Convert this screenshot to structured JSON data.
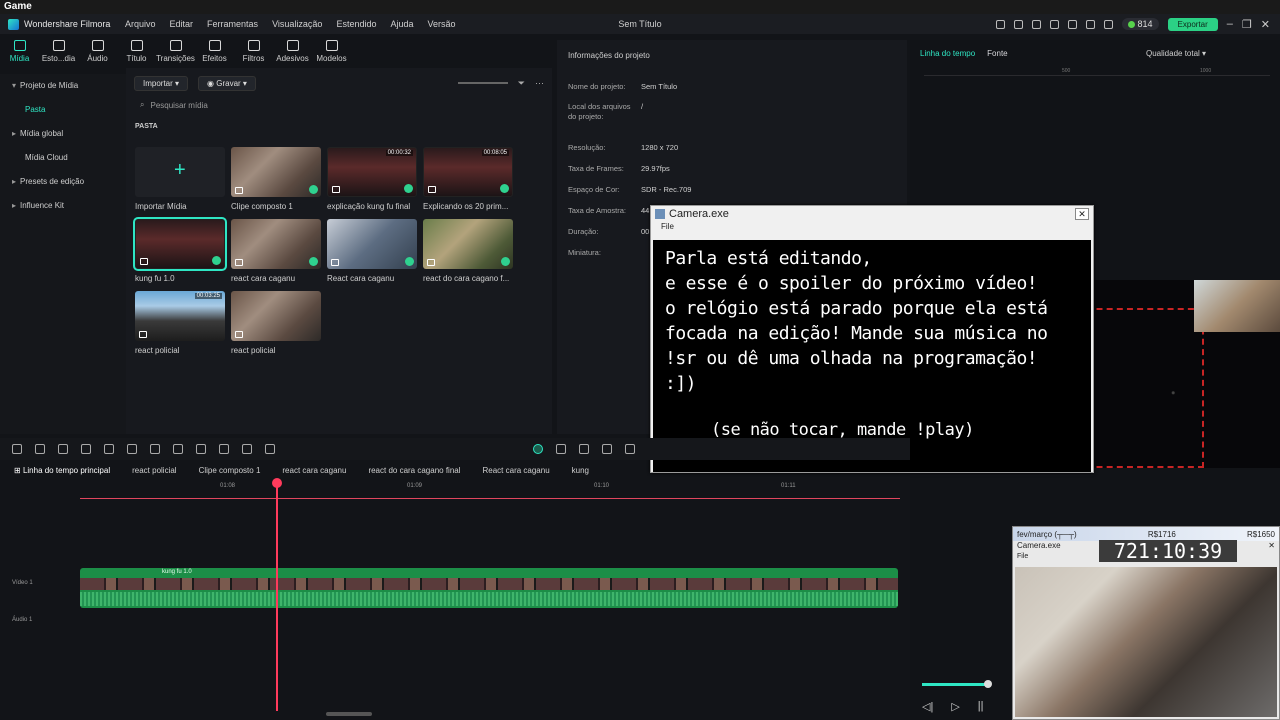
{
  "os_title": "Game",
  "app": {
    "name": "Wondershare Filmora",
    "window_title": "Sem Título",
    "menu": [
      "Arquivo",
      "Editar",
      "Ferramentas",
      "Visualização",
      "Estendido",
      "Ajuda",
      "Versão"
    ],
    "credits": "814",
    "export_label": "Exportar"
  },
  "media_tabs": [
    {
      "label": "Mídia",
      "active": true
    },
    {
      "label": "Esto...dia"
    },
    {
      "label": "Áudio"
    },
    {
      "label": "Título"
    },
    {
      "label": "Transições"
    },
    {
      "label": "Efeitos"
    },
    {
      "label": "Filtros"
    },
    {
      "label": "Adesivos"
    },
    {
      "label": "Modelos"
    }
  ],
  "tree": [
    {
      "label": "Projeto de Mídia",
      "expanded": true
    },
    {
      "label": "Pasta",
      "selected": true
    },
    {
      "label": "Mídia global"
    },
    {
      "label": "Mídia Cloud"
    },
    {
      "label": "Presets de edição"
    },
    {
      "label": "Influence Kit"
    }
  ],
  "media_controls": {
    "import": "Importar",
    "record": "Gravar",
    "search_placeholder": "Pesquisar mídia"
  },
  "folder_label": "PASTA",
  "media_items": [
    {
      "label": "Importar Mídia",
      "kind": "importer"
    },
    {
      "label": "Clipe composto 1",
      "kind": "hand",
      "check": true
    },
    {
      "label": "explicação kung fu final",
      "kind": "red",
      "duration": "00:00:32",
      "check": true
    },
    {
      "label": "Explicando os 20 prim...",
      "kind": "red",
      "duration": "00:08:05",
      "check": true
    },
    {
      "label": "kung fu 1.0",
      "kind": "red",
      "selected": true,
      "check": true
    },
    {
      "label": "react cara caganu",
      "kind": "hand",
      "check": true
    },
    {
      "label": "React cara caganu",
      "kind": "blur",
      "check": true
    },
    {
      "label": "react do cara cagano f...",
      "kind": "nature",
      "check": true
    },
    {
      "label": "react policial",
      "kind": "road",
      "duration": "00:03:25"
    },
    {
      "label": "react policial",
      "kind": "hand"
    }
  ],
  "project_info": {
    "title": "Informações do projeto",
    "rows": [
      {
        "label": "Nome do projeto:",
        "value": "Sem Título"
      },
      {
        "label": "Local dos arquivos do projeto:",
        "value": "/"
      },
      {
        "label": "Resolução:",
        "value": "1280 x 720"
      },
      {
        "label": "Taxa de Frames:",
        "value": "29.97fps"
      },
      {
        "label": "Espaço de Cor:",
        "value": "SDR - Rec.709"
      },
      {
        "label": "Taxa de Amostra:",
        "value": "44"
      },
      {
        "label": "Duração:",
        "value": "00"
      },
      {
        "label": "Miniatura:",
        "value": ""
      }
    ]
  },
  "preview": {
    "tab_timeline": "Linha do tempo",
    "tab_source": "Fonte",
    "quality": "Qualidade total",
    "ruler_ticks": [
      "500",
      "1000"
    ]
  },
  "camera_window": {
    "title": "Camera.exe",
    "menu": "File",
    "lines": [
      "Parla está editando,",
      "e esse é o spoiler do próximo vídeo!",
      "o relógio está parado porque ela está",
      "focada na edição! Mande sua música no",
      "!sr ou dê uma olhada na programação!",
      ":])"
    ],
    "note": "(se não tocar, mande !play)"
  },
  "stream_overlay": {
    "month": "fev/março (┬─┬)",
    "goal_a": "R$1716",
    "goal_b": "R$1650",
    "window_title": "Camera.exe",
    "menu": "File",
    "clock": "721:10:39"
  },
  "timeline": {
    "tabs": [
      "Linha do tempo principal",
      "react policial",
      "Clipe composto 1",
      "react cara caganu",
      "react do cara cagano final",
      "React cara caganu",
      "kung"
    ],
    "ticks": [
      "01:08",
      "01:09",
      "01:10",
      "01:11"
    ],
    "video_track": "Vídeo 1",
    "audio_track": "Áudio 1",
    "clip_name": "kung fu 1.0"
  },
  "colors": {
    "accent": "#2fe6c4",
    "playhead": "#ff3b5c",
    "clip": "#1c8e47"
  }
}
